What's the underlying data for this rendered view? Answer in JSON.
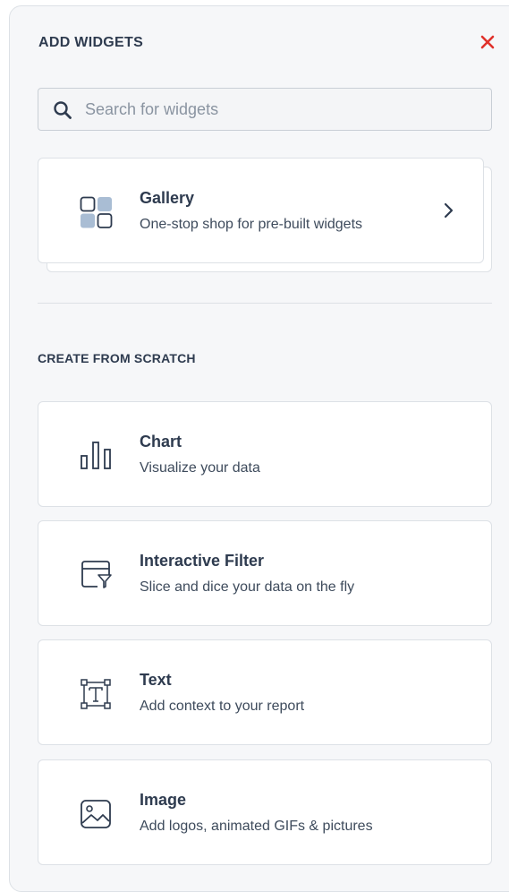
{
  "header": {
    "title": "ADD WIDGETS",
    "close_icon": "close-icon",
    "close_color": "#e0312b"
  },
  "search": {
    "value": "",
    "placeholder": "Search for widgets",
    "icon": "search-icon"
  },
  "gallery": {
    "title": "Gallery",
    "description": "One-stop shop for pre-built widgets",
    "icon": "gallery-icon",
    "action_icon": "chevron-right-icon"
  },
  "scratch": {
    "section_title": "CREATE FROM SCRATCH",
    "items": [
      {
        "title": "Chart",
        "description": "Visualize your data",
        "icon": "bar-chart-icon"
      },
      {
        "title": "Interactive Filter",
        "description": "Slice and dice your data on the fly",
        "icon": "filter-window-icon"
      },
      {
        "title": "Text",
        "description": "Add context to your report",
        "icon": "text-box-icon"
      },
      {
        "title": "Image",
        "description": "Add logos, animated GIFs & pictures",
        "icon": "image-icon"
      }
    ]
  },
  "colors": {
    "icon_primary": "#2e3b4f",
    "icon_accent": "#a9bdd4",
    "panel_background": "#f6f7f9"
  }
}
